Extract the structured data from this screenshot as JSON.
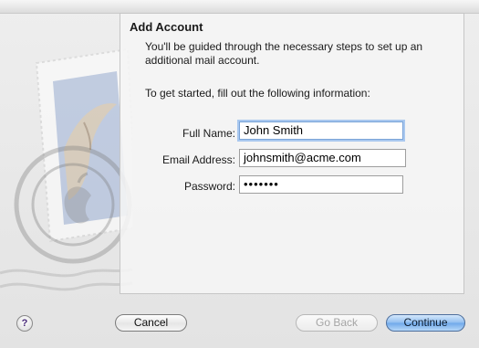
{
  "panel": {
    "title": "Add Account",
    "intro": "You'll be guided through the necessary steps to set up an additional mail account.",
    "prompt": "To get started, fill out the following information:"
  },
  "form": {
    "full_name_label": "Full Name:",
    "full_name_value": "John Smith",
    "email_label": "Email Address:",
    "email_value": "johnsmith@acme.com",
    "password_label": "Password:",
    "password_value": "•••••••"
  },
  "buttons": {
    "help": "?",
    "cancel": "Cancel",
    "back": "Go Back",
    "continue": "Continue"
  },
  "colors": {
    "default_button": "#6ea8ea",
    "focus_ring": "#a9c8ef"
  }
}
